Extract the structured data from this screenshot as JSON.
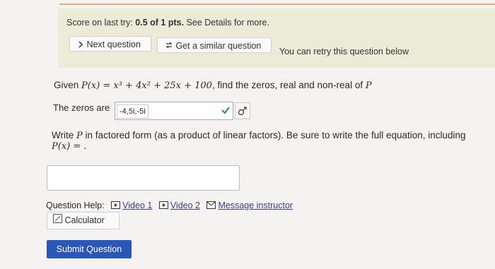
{
  "score": {
    "prefix": "Score on last try:",
    "value": "0.5 of 1 pts.",
    "suffix": "See Details for more."
  },
  "buttons": {
    "next_question": "Next question",
    "similar_question": "Get a similar question",
    "retry_text": "You can retry this question below"
  },
  "question": {
    "given": "Given",
    "function": "P(x) = x³ + 4x² + 25x + 100",
    "find_text": ", find the zeros, real and non-real of",
    "var": "P"
  },
  "zeros": {
    "label": "The zeros are",
    "value": "-4,5i,-5i"
  },
  "factored": {
    "line1_prefix": "Write",
    "line1_var": "P",
    "line1_rest": "in factored form (as a product of linear factors). Be sure to write the full equation, including",
    "line2": "P(x) = ."
  },
  "answer": {
    "value": ""
  },
  "help": {
    "label": "Question Help:",
    "video1": "Video 1",
    "video2": "Video 2",
    "message": "Message instructor",
    "calculator": "Calculator"
  },
  "submit": {
    "label": "Submit Question"
  },
  "colors": {
    "submit_bg": "#2a56b5",
    "panel_bg": "#ecebd8",
    "link": "#3c3c8c",
    "check": "#2e8b57"
  }
}
